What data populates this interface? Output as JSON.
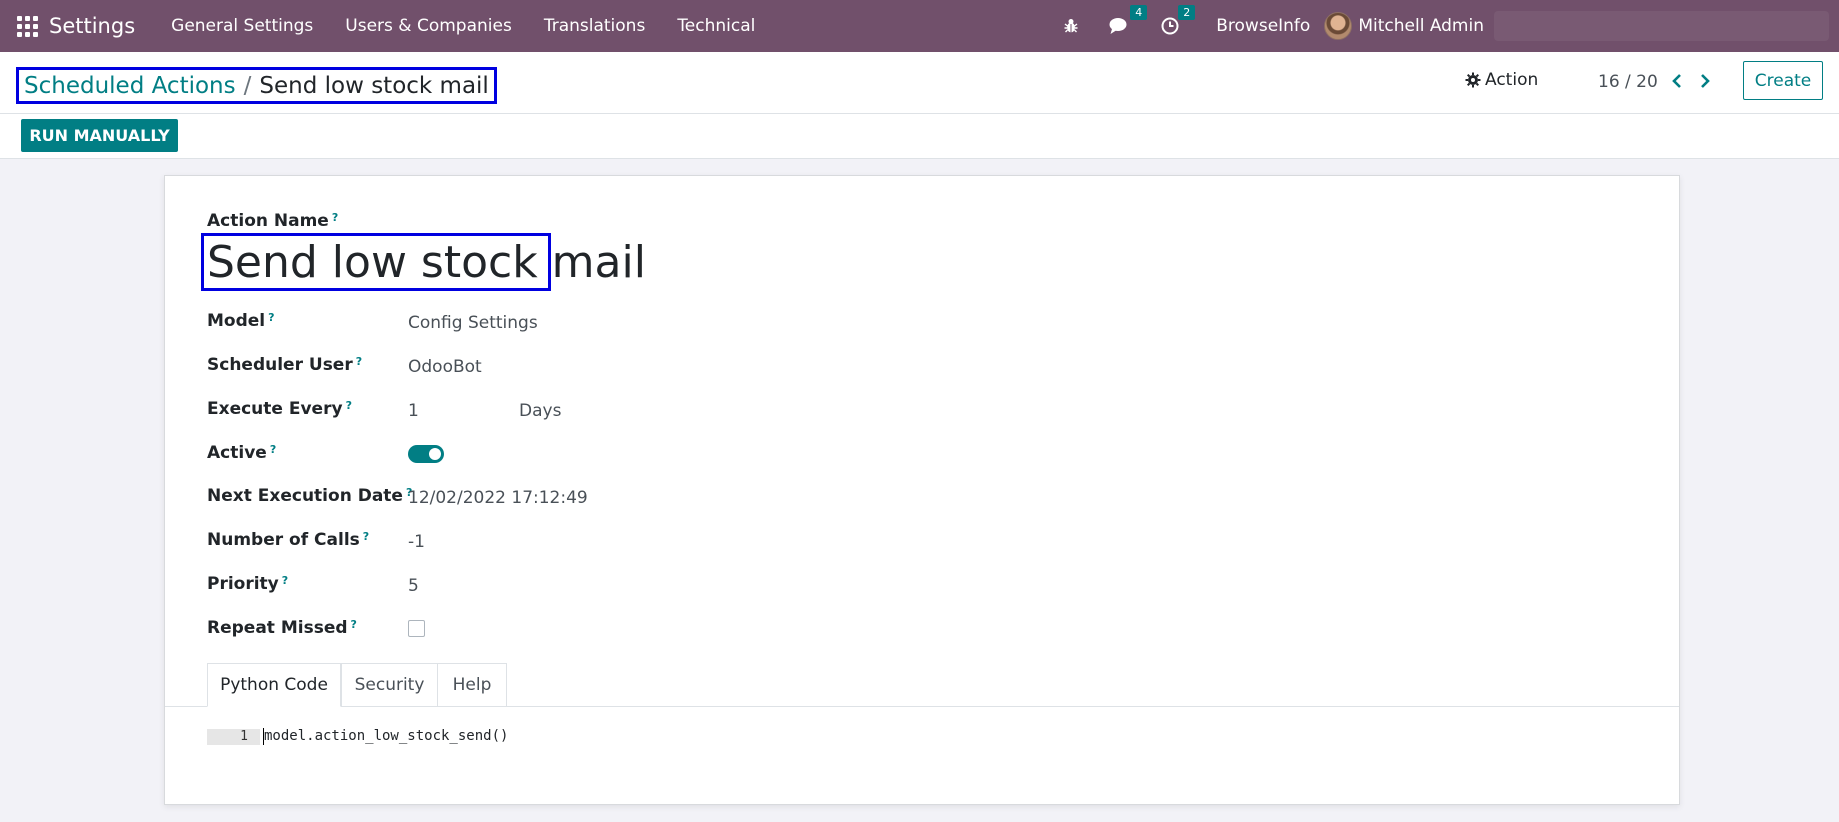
{
  "navbar": {
    "app_name": "Settings",
    "menu": [
      "General Settings",
      "Users & Companies",
      "Translations",
      "Technical"
    ],
    "messages_count": "4",
    "activities_count": "2",
    "company": "BrowseInfo",
    "user": "Mitchell Admin"
  },
  "control_panel": {
    "breadcrumb_parent": "Scheduled Actions",
    "breadcrumb_separator": "/",
    "breadcrumb_current": "Send low stock mail",
    "action_label": "Action",
    "pager": "16 / 20",
    "create_label": "Create",
    "run_manually_label": "RUN MANUALLY"
  },
  "form": {
    "action_name_label": "Action Name",
    "action_name_value": "Send low stock mail",
    "help_marker": "?",
    "fields": {
      "model_label": "Model",
      "model_value": "Config Settings",
      "scheduler_user_label": "Scheduler User",
      "scheduler_user_value": "OdooBot",
      "execute_every_label": "Execute Every",
      "execute_every_value": "1",
      "execute_every_unit": "Days",
      "active_label": "Active",
      "active_value": true,
      "next_execution_label": "Next Execution Date",
      "next_execution_value": "12/02/2022 17:12:49",
      "number_of_calls_label": "Number of Calls",
      "number_of_calls_value": "-1",
      "priority_label": "Priority",
      "priority_value": "5",
      "repeat_missed_label": "Repeat Missed",
      "repeat_missed_value": false
    },
    "tabs": [
      "Python Code",
      "Security",
      "Help"
    ],
    "active_tab": "Python Code",
    "code": {
      "line_number": "1",
      "line": "model.action_low_stock_send()"
    }
  },
  "colors": {
    "navbar": "#71506b",
    "accent": "#017e84",
    "highlight_box": "#0000e0"
  }
}
